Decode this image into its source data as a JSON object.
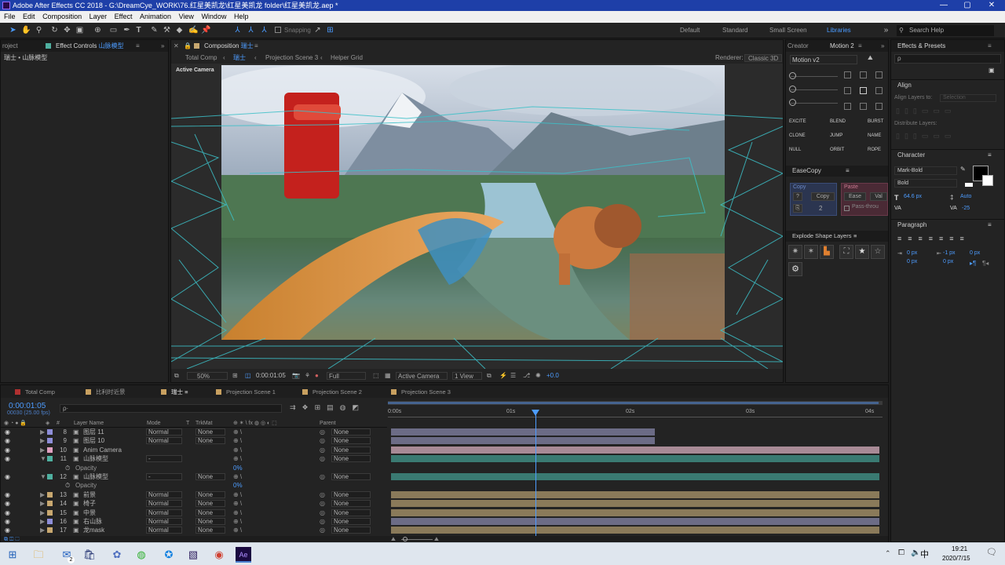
{
  "window": {
    "title": "Adobe After Effects CC 2018 - G:\\DreamCye_WORK\\76.红星美凯龙\\红星美凯龙 folder\\红星美凯龙.aep *"
  },
  "menu": [
    "File",
    "Edit",
    "Composition",
    "Layer",
    "Effect",
    "Animation",
    "View",
    "Window",
    "Help"
  ],
  "toolbar": {
    "snapping": "Snapping",
    "workspaces": [
      "Default",
      "Standard",
      "Small Screen",
      "Libraries"
    ],
    "active_workspace": "Libraries",
    "search_placeholder": "Search Help"
  },
  "project_panel": {
    "tab1": "roject",
    "tab2_prefix": "Effect Controls",
    "tab2_layer": "山脉模型",
    "breadcrumb": "瑞士 • 山脉模型"
  },
  "comp_panel": {
    "tab_prefix": "Composition",
    "tab_name": "瑞士",
    "flow": [
      "Total Comp",
      "瑞士",
      "Projection Scene 3",
      "Helper Grid"
    ],
    "renderer_label": "Renderer:",
    "renderer": "Classic 3D",
    "camera_label": "Active Camera",
    "footer": {
      "zoom": "50%",
      "time": "0:00:01:05",
      "resolution": "Full",
      "camera": "Active Camera",
      "views": "1 View",
      "exposure": "+0.0"
    }
  },
  "right_panel1": {
    "tabs": [
      "Creator",
      "Motion 2"
    ],
    "preset": "Motion v2",
    "actions": [
      "EXCITE",
      "BLEND",
      "BURST",
      "CLONE",
      "JUMP",
      "NAME",
      "NULL",
      "ORBIT",
      "ROPE"
    ]
  },
  "easecopy": {
    "title": "EaseCopy",
    "copy_group": "Copy",
    "copy_btn": "Copy",
    "copy_value": "2",
    "paste_group": "Paste",
    "ease_btn": "Ease",
    "value_btn": "Val",
    "passthrough": "Pass-throu"
  },
  "explode": {
    "title": "Explode Shape Layers"
  },
  "effects_presets": {
    "title": "Effects & Presets",
    "search_placeholder": "ρ"
  },
  "align": {
    "title": "Align",
    "align_to_label": "Align Layers to:",
    "align_to_value": "Selection",
    "distribute_label": "Distribute Layers:"
  },
  "character": {
    "title": "Character",
    "font": "Mark-Bold",
    "style": "Bold",
    "size": "64.6 px",
    "leading": "Auto",
    "kerning_label": "VA",
    "tracking": "-25"
  },
  "paragraph": {
    "title": "Paragraph",
    "indent_left": "0 px",
    "indent_right": "-1 px",
    "indent_first": "0 px",
    "space_before": "0 px",
    "space_after": "0 px"
  },
  "timeline": {
    "tabs": [
      {
        "label": "Total Comp",
        "color": "#b03030"
      },
      {
        "label": "比利时近景",
        "color": "#c8a060"
      },
      {
        "label": "瑞士",
        "color": "#c8a060",
        "active": true
      },
      {
        "label": "Projection Scene 1",
        "color": "#c8a060"
      },
      {
        "label": "Projection Scene 2",
        "color": "#c8a060"
      },
      {
        "label": "Projection Scene 3",
        "color": "#c8a060"
      }
    ],
    "timecode": "0:00:01:05",
    "frames": "00030 (25.00 fps)",
    "search_placeholder": "ρ·",
    "columns": {
      "hash": "#",
      "layer_name": "Layer Name",
      "mode": "Mode",
      "t": "T",
      "trkmat": "TrkMat",
      "parent": "Parent"
    },
    "ruler": [
      "0:00s",
      "01s",
      "02s",
      "03s",
      "04s"
    ],
    "layers": [
      {
        "num": "8",
        "name": "图层 11",
        "mode": "Normal",
        "trkmat": "None",
        "parent": "None",
        "label_color": "#8e8ed8"
      },
      {
        "num": "9",
        "name": "图层 10",
        "mode": "Normal",
        "trkmat": "None",
        "parent": "None",
        "label_color": "#8e8ed8"
      },
      {
        "num": "10",
        "name": "Anim Camera",
        "mode": "",
        "trkmat": "",
        "parent": "None",
        "label_color": "#e0a0c0"
      },
      {
        "num": "11",
        "name": "山脉模型",
        "mode": "-",
        "trkmat": "",
        "parent": "None",
        "label_color": "#4fb0a0"
      },
      {
        "sub": true,
        "name": "Opacity",
        "value": "0%"
      },
      {
        "num": "12",
        "name": "山脉模型",
        "mode": "-",
        "trkmat": "None",
        "parent": "None",
        "label_color": "#4fb0a0"
      },
      {
        "sub": true,
        "name": "Opacity",
        "value": "0%"
      },
      {
        "num": "13",
        "name": "前景",
        "mode": "Normal",
        "trkmat": "None",
        "parent": "None",
        "label_color": "#c8a870"
      },
      {
        "num": "14",
        "name": "椅子",
        "mode": "Normal",
        "trkmat": "None",
        "parent": "None",
        "label_color": "#c8a870"
      },
      {
        "num": "15",
        "name": "中景",
        "mode": "Normal",
        "trkmat": "None",
        "parent": "None",
        "label_color": "#c8a870"
      },
      {
        "num": "16",
        "name": "右山脉",
        "mode": "Normal",
        "trkmat": "None",
        "parent": "None",
        "label_color": "#8e8ed8"
      },
      {
        "num": "17",
        "name": "龙mask",
        "mode": "Normal",
        "trkmat": "None",
        "parent": "None",
        "label_color": "#c8a870"
      }
    ]
  },
  "taskbar": {
    "ime": "中",
    "time": "19:21",
    "date": "2020/7/15",
    "mail_badge": "2"
  }
}
